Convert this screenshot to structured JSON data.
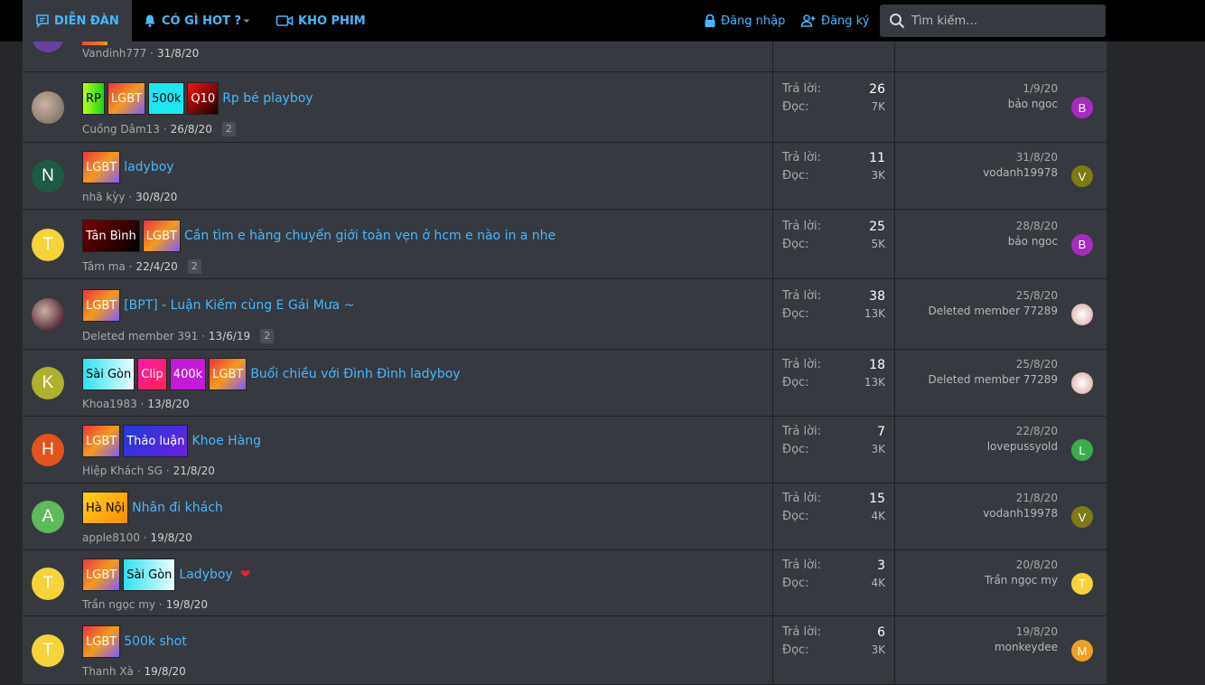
{
  "nav": {
    "forum": "DIỄN ĐÀN",
    "hot": "CÓ GÌ HOT ?",
    "movies": "KHO PHIM",
    "login": "Đăng nhập",
    "register": "Đăng ký",
    "search_placeholder": "Tìm kiếm…"
  },
  "stats_labels": {
    "replies": "Trả lời:",
    "views": "Đọc:"
  },
  "top_partial": {
    "author": "Vandinh777",
    "date": "31/8/20"
  },
  "threads": [
    {
      "avatar_letter": "",
      "avatar_color": "#8a7b6e",
      "labels": [
        {
          "text": "RP",
          "bg": "linear-gradient(90deg,#b6ff1a,#1bd51b)",
          "color": "#000"
        },
        {
          "text": "LGBT",
          "bg": "linear-gradient(135deg,#e93344,#f59a1b,#7b5cff)",
          "color": "#fff"
        },
        {
          "text": "500k",
          "bg": "#1ce9ef",
          "color": "#000"
        },
        {
          "text": "Q10",
          "bg": "linear-gradient(135deg,#ff1010,#110000)",
          "color": "#fff"
        }
      ],
      "title": "Rp bé playboy",
      "author": "Cuồng Dâm13",
      "date": "26/8/20",
      "pages": "2",
      "replies": "26",
      "views": "7K",
      "last_date": "1/9/20",
      "last_user": "bảo ngoc",
      "last_letter": "B",
      "last_color": "#a62bc2"
    },
    {
      "avatar_letter": "N",
      "avatar_color": "#1c5a45",
      "labels": [
        {
          "text": "LGBT",
          "bg": "linear-gradient(135deg,#e93344,#f59a1b,#7b5cff)",
          "color": "#fff"
        }
      ],
      "title": "ladyboy",
      "author": "nhã kỳy",
      "date": "30/8/20",
      "pages": "",
      "replies": "11",
      "views": "3K",
      "last_date": "31/8/20",
      "last_user": "vodanh19978",
      "last_letter": "V",
      "last_color": "#7e7a14"
    },
    {
      "avatar_letter": "T",
      "avatar_color": "#f5d33a",
      "labels": [
        {
          "text": "Tân Bình",
          "bg": "linear-gradient(135deg,#7a0000,#000)",
          "color": "#fff"
        },
        {
          "text": "LGBT",
          "bg": "linear-gradient(135deg,#e93344,#f59a1b,#7b5cff)",
          "color": "#fff"
        }
      ],
      "title": "Cần tìm e hàng chuyển giới toàn vẹn ở hcm e nào in a nhe",
      "author": "Tâm ma",
      "date": "22/4/20",
      "pages": "2",
      "replies": "25",
      "views": "5K",
      "last_date": "28/8/20",
      "last_user": "bảo ngoc",
      "last_letter": "B",
      "last_color": "#a62bc2"
    },
    {
      "avatar_letter": "",
      "avatar_color": "#5a2e3e",
      "labels": [
        {
          "text": "LGBT",
          "bg": "linear-gradient(135deg,#e93344,#f59a1b,#7b5cff)",
          "color": "#fff"
        }
      ],
      "title": "[BPT] - Luận Kiếm cùng E Gái Mưa ~",
      "author": "Deleted member 391",
      "date": "13/6/19",
      "pages": "2",
      "replies": "38",
      "views": "13K",
      "last_date": "25/8/20",
      "last_user": "Deleted member 77289",
      "last_letter": "",
      "last_color": "#e7c7c4"
    },
    {
      "avatar_letter": "K",
      "avatar_color": "#aeb12a",
      "labels": [
        {
          "text": "Sài Gòn",
          "bg": "linear-gradient(90deg,#2fe1f0,#eaffff)",
          "color": "#000"
        },
        {
          "text": "Clip",
          "bg": "linear-gradient(135deg,#ff1aa8,#ff2250)",
          "color": "#fff"
        },
        {
          "text": "400k",
          "bg": "#c319d8",
          "color": "#fff"
        },
        {
          "text": "LGBT",
          "bg": "linear-gradient(135deg,#e93344,#f59a1b,#7b5cff)",
          "color": "#fff"
        }
      ],
      "title": "Buổi chiều với Đình Đình ladyboy",
      "author": "Khoa1983",
      "date": "13/8/20",
      "pages": "",
      "replies": "18",
      "views": "13K",
      "last_date": "25/8/20",
      "last_user": "Deleted member 77289",
      "last_letter": "",
      "last_color": "#e7c7c4"
    },
    {
      "avatar_letter": "H",
      "avatar_color": "#e4531c",
      "labels": [
        {
          "text": "LGBT",
          "bg": "linear-gradient(135deg,#e93344,#f59a1b,#7b5cff)",
          "color": "#fff"
        },
        {
          "text": "Thảo luận",
          "bg": "linear-gradient(135deg,#1f3bd9,#6a1fe0)",
          "color": "#fff"
        }
      ],
      "title": "Khoe Hàng",
      "author": "Hiệp Khách SG",
      "date": "21/8/20",
      "pages": "",
      "replies": "7",
      "views": "3K",
      "last_date": "22/8/20",
      "last_user": "lovepussyold",
      "last_letter": "L",
      "last_color": "#3bad4c"
    },
    {
      "avatar_letter": "A",
      "avatar_color": "#5eba5b",
      "labels": [
        {
          "text": "Hà Nội",
          "bg": "linear-gradient(135deg,#ffd21a,#ff8a00)",
          "color": "#000"
        }
      ],
      "title": "Nhân đi khách",
      "author": "apple8100",
      "date": "19/8/20",
      "pages": "",
      "replies": "15",
      "views": "4K",
      "last_date": "21/8/20",
      "last_user": "vodanh19978",
      "last_letter": "V",
      "last_color": "#7e7a14"
    },
    {
      "avatar_letter": "T",
      "avatar_color": "#f5d33a",
      "labels": [
        {
          "text": "LGBT",
          "bg": "linear-gradient(135deg,#e93344,#f59a1b,#7b5cff)",
          "color": "#fff"
        },
        {
          "text": "Sài Gòn",
          "bg": "linear-gradient(90deg,#2fe1f0,#eaffff)",
          "color": "#000"
        }
      ],
      "title": "Ladyboy",
      "author": "Trần ngọc my",
      "date": "19/8/20",
      "pages": "",
      "heart": "❤",
      "replies": "3",
      "views": "4K",
      "last_date": "20/8/20",
      "last_user": "Trần ngọc my",
      "last_letter": "T",
      "last_color": "#f5d33a"
    },
    {
      "avatar_letter": "T",
      "avatar_color": "#f5d33a",
      "labels": [
        {
          "text": "LGBT",
          "bg": "linear-gradient(135deg,#e93344,#f59a1b,#7b5cff)",
          "color": "#fff"
        }
      ],
      "title": "500k shot",
      "author": "Thanh Xà",
      "date": "19/8/20",
      "pages": "",
      "replies": "6",
      "views": "3K",
      "last_date": "19/8/20",
      "last_user": "monkeydee",
      "last_letter": "M",
      "last_color": "#f0a020"
    }
  ]
}
